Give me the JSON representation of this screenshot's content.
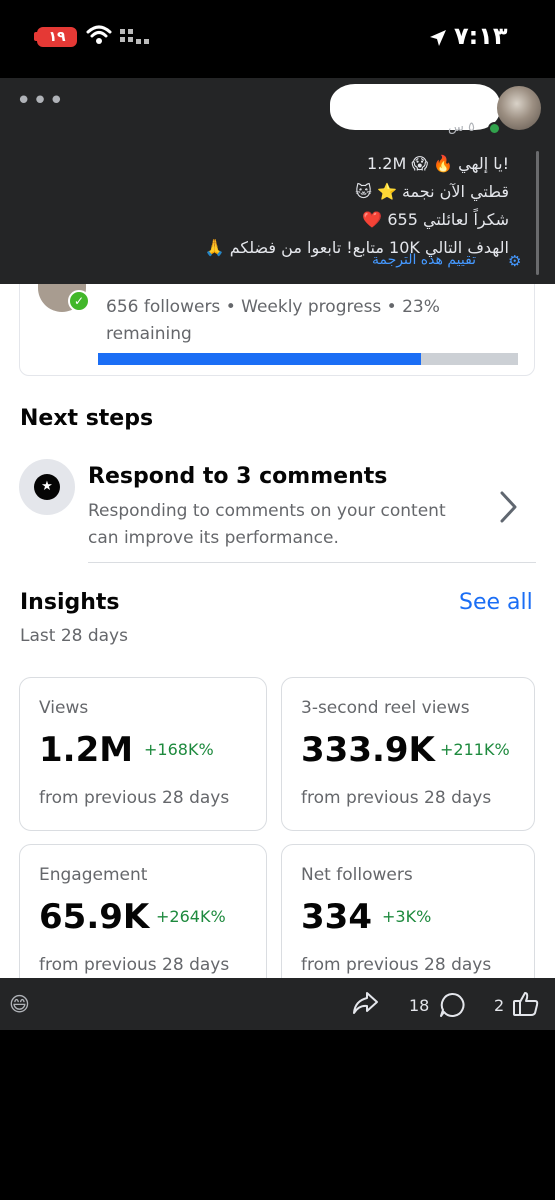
{
  "status_bar": {
    "battery": "١٩",
    "time": "٧:١٣",
    "icons": [
      "battery-icon",
      "wifi-icon",
      "signal-icon",
      "location-arrow-icon"
    ]
  },
  "post": {
    "more": "•••",
    "time": "٥ س",
    "lines": [
      "!يا إلهي 🔥 😱 1.2M",
      "قطتي الآن نجمة ⭐ 🐱",
      "شكراً لعائلتي 655 ❤️",
      "الهدف التالي 10K متابع! تابعوا من فضلكم 🙏"
    ],
    "translate_link": "تقييم هذه الترجمة"
  },
  "progress_card": {
    "text": "656 followers • Weekly progress • 23% remaining",
    "progress_fraction": 0.77
  },
  "next_steps": {
    "title": "Next steps",
    "item_title": "Respond to 3 comments",
    "item_desc": "Responding to comments on your content can improve its performance."
  },
  "insights": {
    "title": "Insights",
    "see_all": "See all",
    "subtitle": "Last 28 days",
    "metrics": [
      {
        "label": "Views",
        "value": "1.2M",
        "delta": "+168K%",
        "foot": "from previous 28 days"
      },
      {
        "label": "3-second reel views",
        "value": "333.9K",
        "delta": "+211K%",
        "foot": "from previous 28 days"
      },
      {
        "label": "Engagement",
        "value": "65.9K",
        "delta": "+264K%",
        "foot": "from previous 28 days"
      },
      {
        "label": "Net followers",
        "value": "334",
        "delta": "+3K%",
        "foot": "from previous 28 days"
      }
    ]
  },
  "actions": {
    "comment_count": "18",
    "like_count": "2"
  },
  "colors": {
    "accent": "#1b6ef5",
    "positive": "#1e8a3e",
    "dark_bg": "#242526"
  }
}
